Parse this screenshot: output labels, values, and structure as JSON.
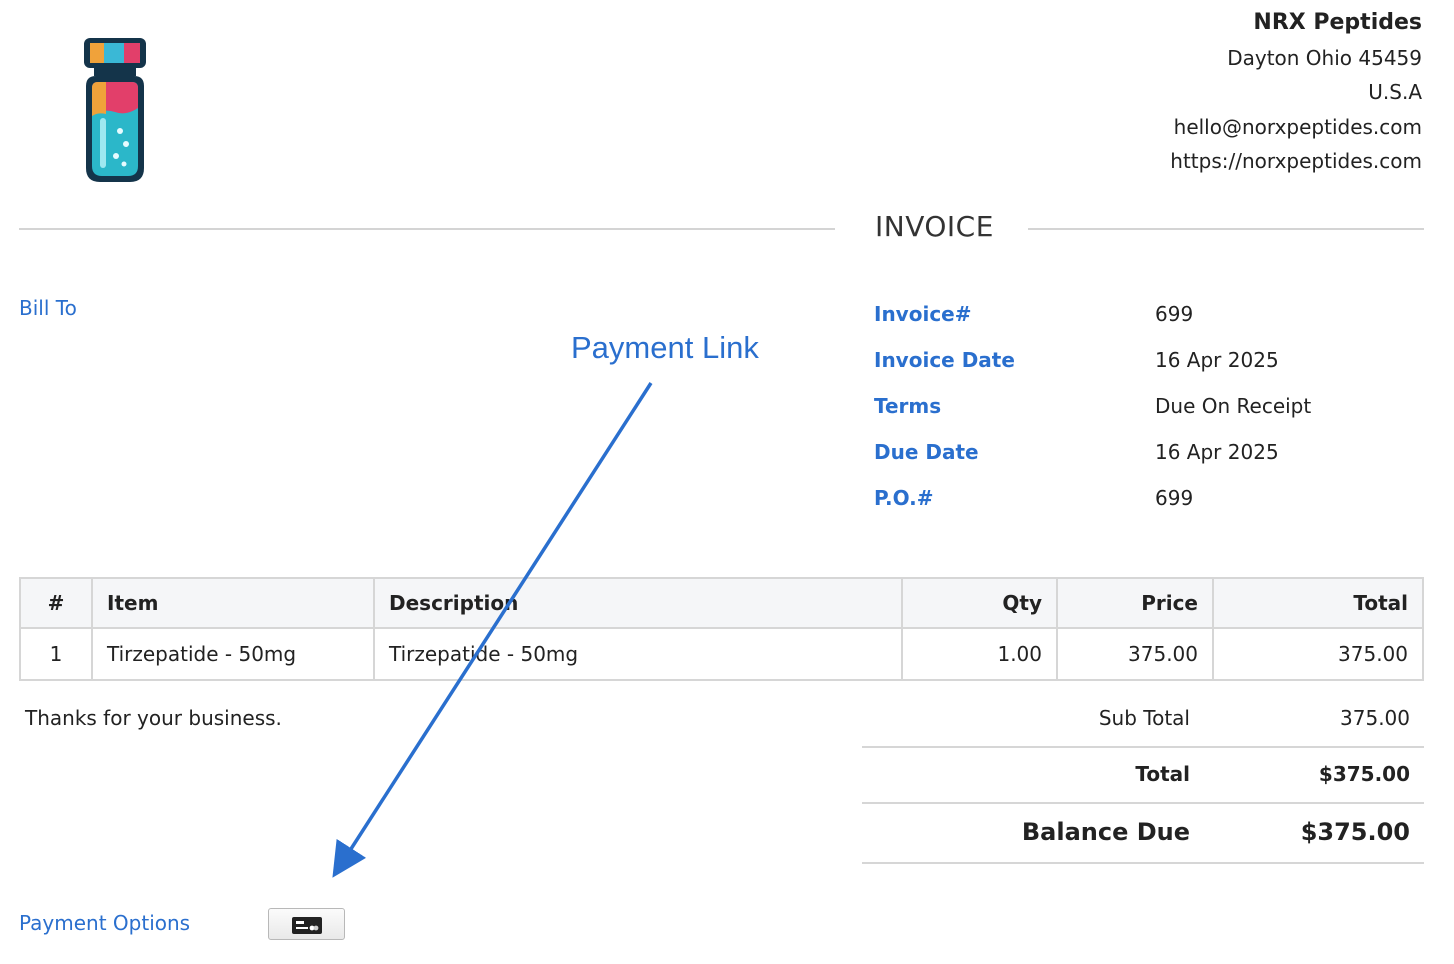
{
  "company": {
    "name": "NRX Peptides",
    "address_line1": "Dayton Ohio 45459",
    "country": "U.S.A",
    "email": "hello@norxpeptides.com",
    "website": "https://norxpeptides.com"
  },
  "document_title": "INVOICE",
  "bill_to_label": "Bill To",
  "annotation": "Payment Link",
  "meta": [
    {
      "label": "Invoice#",
      "value": "699"
    },
    {
      "label": "Invoice Date",
      "value": "16 Apr 2025"
    },
    {
      "label": "Terms",
      "value": "Due On Receipt"
    },
    {
      "label": "Due Date",
      "value": "16 Apr 2025"
    },
    {
      "label": "P.O.#",
      "value": "699"
    }
  ],
  "table": {
    "headers": {
      "num": "#",
      "item": "Item",
      "description": "Description",
      "qty": "Qty",
      "price": "Price",
      "total": "Total"
    },
    "rows": [
      {
        "num": "1",
        "item": "Tirzepatide - 50mg",
        "description": "Tirzepatide - 50mg",
        "qty": "1.00",
        "price": "375.00",
        "total": "375.00"
      }
    ]
  },
  "notes": "Thanks for your business.",
  "totals": {
    "subtotal_label": "Sub Total",
    "subtotal_value": "375.00",
    "total_label": "Total",
    "total_value": "$375.00",
    "balance_label": "Balance Due",
    "balance_value": "$375.00"
  },
  "payment_options_label": "Payment Options",
  "icons": {
    "logo": "vial-logo-icon",
    "payment": "credit-card-icon"
  },
  "colors": {
    "accent": "#2a6fce",
    "rule": "#d6d6d6",
    "header_bg": "#f5f6f8"
  }
}
